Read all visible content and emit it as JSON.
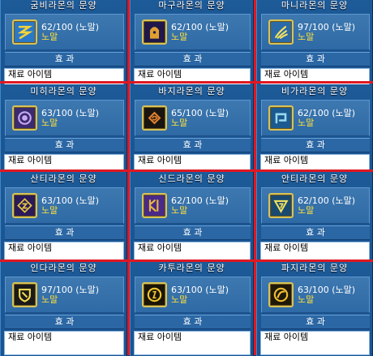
{
  "effect_label": "효 과",
  "material_label": "재료 아이템",
  "grade_label": "노말",
  "panels": [
    {
      "title": "굼비라몬의 문양",
      "count": "62/100 (노말)",
      "icon": "glyph-zigzag-icon",
      "icon_bg": "#2a78c8",
      "icon_fg": "#f2d23a"
    },
    {
      "title": "마구라몬의 문양",
      "count": "62/100 (노말)",
      "icon": "glyph-crest-icon",
      "icon_bg": "#20184a",
      "icon_fg": "#e0a030"
    },
    {
      "title": "마니라몬의 문양",
      "count": "97/100 (노말)",
      "icon": "glyph-claw-icon",
      "icon_bg": "#2a6aa8",
      "icon_fg": "#f4e060"
    },
    {
      "title": "미히라몬의 문양",
      "count": "63/100 (노말)",
      "icon": "glyph-ring-icon",
      "icon_bg": "#3a2a70",
      "icon_fg": "#c8a8f0"
    },
    {
      "title": "바지라몬의 문양",
      "count": "65/100 (노말)",
      "icon": "glyph-swirl-icon",
      "icon_bg": "#1a1410",
      "icon_fg": "#e08030"
    },
    {
      "title": "비가라몬의 문양",
      "count": "62/100 (노말)",
      "icon": "glyph-hook-icon",
      "icon_bg": "#1a5a90",
      "icon_fg": "#9ad8f0"
    },
    {
      "title": "산티라몬의 문양",
      "count": "63/100 (노말)",
      "icon": "glyph-diamond-icon",
      "icon_bg": "#2a1a5a",
      "icon_fg": "#e8c840"
    },
    {
      "title": "신드라몬의 문양",
      "count": "62/100 (노말)",
      "icon": "glyph-rune-icon",
      "icon_bg": "#4a2a88",
      "icon_fg": "#e8b840"
    },
    {
      "title": "안티라몬의 문양",
      "count": "62/100 (노말)",
      "icon": "glyph-triangle-icon",
      "icon_bg": "#1a4a70",
      "icon_fg": "#f0e060"
    },
    {
      "title": "인다라몬의 문양",
      "count": "97/100 (노말)",
      "icon": "glyph-shield-icon",
      "icon_bg": "#1a1a1a",
      "icon_fg": "#f0d850"
    },
    {
      "title": "카투라몬의 문양",
      "count": "63/100 (노말)",
      "icon": "glyph-coin-icon",
      "icon_bg": "#1a1408",
      "icon_fg": "#f0c830"
    },
    {
      "title": "파지라몬의 문양",
      "count": "63/100 (노말)",
      "icon": "glyph-medal-icon",
      "icon_bg": "#201808",
      "icon_fg": "#f0c030"
    }
  ]
}
